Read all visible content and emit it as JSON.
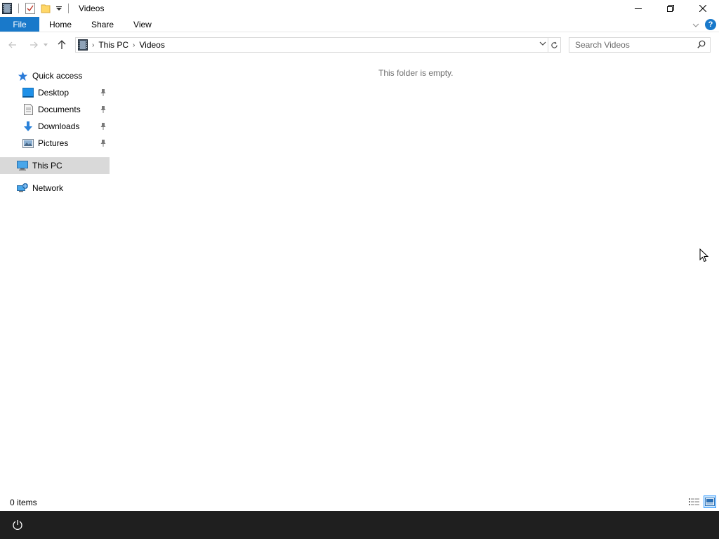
{
  "window": {
    "title": "Videos"
  },
  "ribbon": {
    "tabs": [
      {
        "label": "File"
      },
      {
        "label": "Home"
      },
      {
        "label": "Share"
      },
      {
        "label": "View"
      }
    ],
    "help_label": "?"
  },
  "address_bar": {
    "breadcrumbs": [
      "This PC",
      "Videos"
    ]
  },
  "search": {
    "placeholder": "Search Videos"
  },
  "nav_pane": {
    "quick_access": {
      "label": "Quick access",
      "items": [
        {
          "label": "Desktop",
          "icon": "desktop-icon",
          "pinned": true
        },
        {
          "label": "Documents",
          "icon": "documents-icon",
          "pinned": true
        },
        {
          "label": "Downloads",
          "icon": "downloads-icon",
          "pinned": true
        },
        {
          "label": "Pictures",
          "icon": "pictures-icon",
          "pinned": true
        }
      ]
    },
    "this_pc": {
      "label": "This PC",
      "selected": true
    },
    "network": {
      "label": "Network"
    }
  },
  "content": {
    "empty_message": "This folder is empty."
  },
  "status_bar": {
    "item_count": "0 items"
  },
  "colors": {
    "accent": "#1979ca",
    "selection": "#d9d9d9",
    "taskbar": "#1f1f1f"
  }
}
